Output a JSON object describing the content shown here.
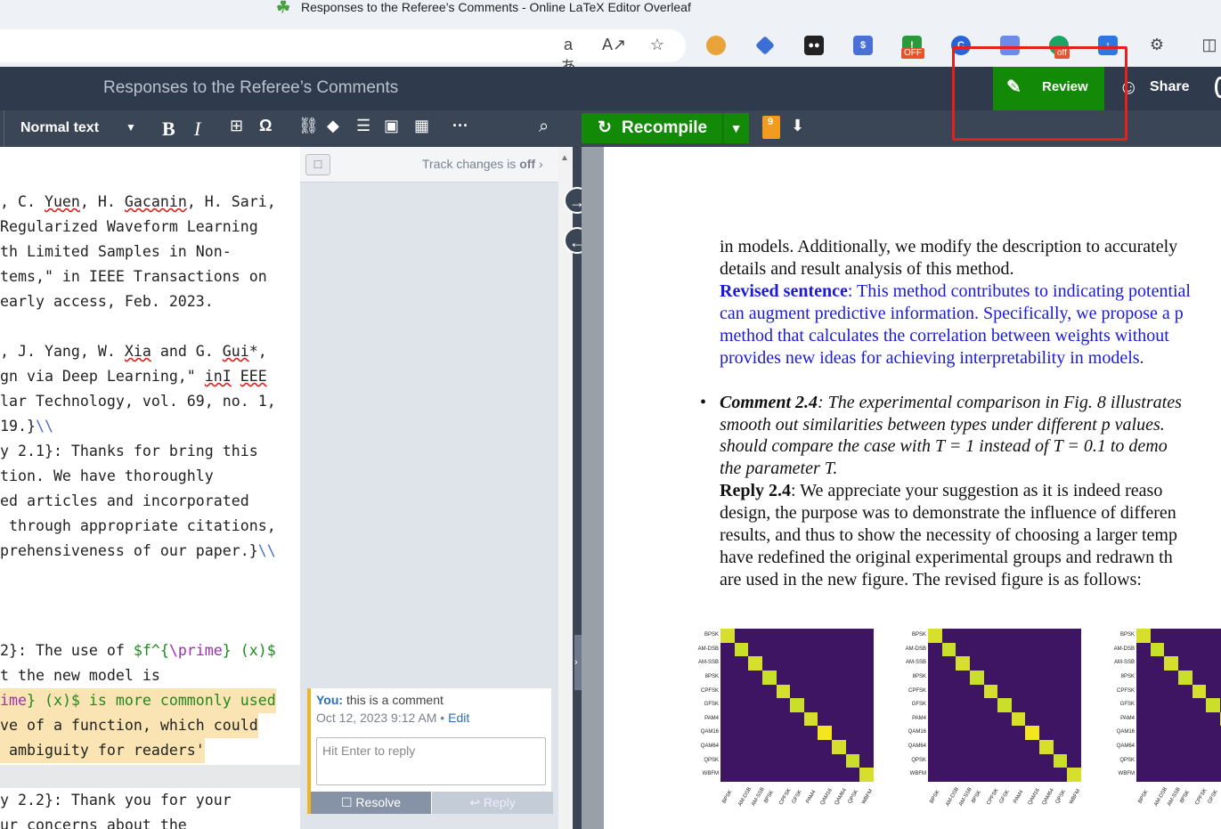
{
  "browser": {
    "tab_title": "Responses to the Referee’s Comments - Online LaTeX Editor Overleaf",
    "ext_off_badge": "OFF",
    "ext_off_badge2": "off"
  },
  "header": {
    "project_title": "Responses to the Referee’s Comments",
    "review_label": "Review",
    "share_label": "Share"
  },
  "editor_toolbar": {
    "style_select": "Normal text",
    "bold": "B",
    "italic": "I",
    "omega": "Ω",
    "more": "···"
  },
  "pdf_toolbar": {
    "recompile_label": "Recompile",
    "log_count": "9"
  },
  "review": {
    "track_label": "Track changes is ",
    "track_state": "off",
    "comment": {
      "author": "You:",
      "text": "this is a comment",
      "time": "Oct 12, 2023 9:12 AM",
      "sep": " • ",
      "edit": "Edit",
      "reply_placeholder": "Hit Enter to reply",
      "resolve": "Resolve",
      "reply": "Reply"
    }
  },
  "code": {
    "l1": ", C. ",
    "l1b": "Yuen",
    "l1c": ", H. ",
    "l1d": "Gacanin",
    "l1e": ", H. Sari,",
    "l2": "Regularized Waveform Learning",
    "l3": "th Limited Samples in Non-",
    "l4": "tems,\" in IEEE Transactions on",
    "l5": "early access, Feb. 2023.",
    "l6a": ", J. Yang, W. ",
    "l6b": "Xia",
    "l6c": " and G. ",
    "l6d": "Gui",
    "l6e": "*,",
    "l7a": "gn via Deep Learning,\" ",
    "l7b": "inI",
    "l7c": " ",
    "l7d": "EEE",
    "l8": "lar Technology, vol. 69, no. 1,",
    "l9a": "19.}",
    "l9b": "\\\\",
    "l10": "y 2.1}: Thanks for bring this",
    "l11": "tion. We have thoroughly",
    "l12": "ed articles and incorporated",
    "l13": " through appropriate citations,",
    "l14a": "prehensiveness of our paper.}",
    "l14b": "\\\\",
    "l15a": "2}: The use of ",
    "l15b": "$f^{",
    "l15c": "\\prime",
    "l15d": "} (x)$",
    "l16": "t the new model is",
    "l17a": "ime",
    "l17b": "} (x)$ is more commonly used",
    "l18": "ve of a function, which could",
    "l19": " ambiguity for readers'",
    "l20": "y 2.2}: Thank you for your",
    "l21": "ur concerns about the"
  },
  "pdf": {
    "p1": "in models. Additionally, we modify the description to accurately",
    "p2": "details and result analysis of this method.",
    "p3a": "Revised sentence",
    "p3b": ": This method contributes to indicating potential",
    "p4": "can augment predictive information. Specifically, we propose a p",
    "p5": "method that calculates the correlation between weights without",
    "p6": "provides new ideas for achieving interpretability in models.",
    "c1a": "Comment 2.4",
    "c1b": ": The experimental comparison in Fig. 8 illustrates",
    "c2": "smooth out similarities between types under different p values.",
    "c3": "should compare the case with T = 1 instead of T = 0.1 to demo",
    "c4": "the parameter T.",
    "r1a": "Reply 2.4",
    "r1b": ": We appreciate your suggestion as it is indeed reaso",
    "r2": "design, the purpose was to demonstrate the influence of differen",
    "r3": "results, and thus to show the necessity of choosing a larger temp",
    "r4": "have redefined the original experimental groups and redrawn th",
    "r5": "are used in the new figure. The revised figure is as follows:"
  },
  "chart_data": {
    "type": "heatmap",
    "labels": [
      "BPSK",
      "AM-DSB",
      "AM-SSB",
      "8PSK",
      "CPFSK",
      "GFSK",
      "PAM4",
      "QAM16",
      "QAM64",
      "QPSK",
      "WBFM"
    ],
    "panels": 3
  },
  "colors": {
    "accent": "#138a07",
    "header": "#2f3a4c",
    "highlight": "#e8201c"
  }
}
